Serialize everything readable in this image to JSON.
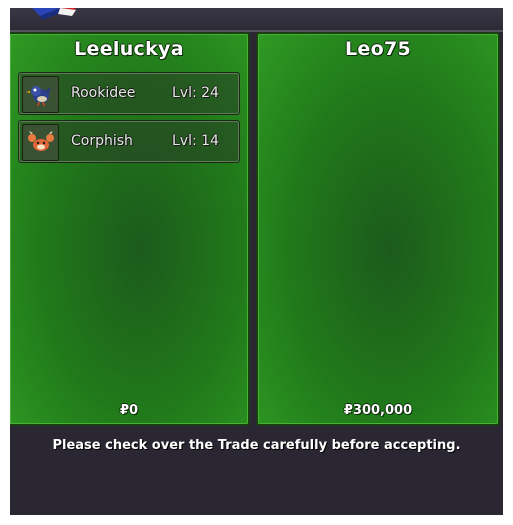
{
  "trade": {
    "left": {
      "player_name": "Leeluckya",
      "pokemon": [
        {
          "name": "Rookidee",
          "level": "Lvl: 24",
          "icon": "rookidee-icon"
        },
        {
          "name": "Corphish",
          "level": "Lvl: 14",
          "icon": "corphish-icon"
        }
      ],
      "money": "₽0"
    },
    "right": {
      "player_name": "Leo75",
      "pokemon": [],
      "money": "₽300,000"
    },
    "footer_message": "Please check over the Trade carefully before accepting."
  },
  "colors": {
    "panel_green": "#217a1a",
    "window_bg": "#2a2733"
  }
}
